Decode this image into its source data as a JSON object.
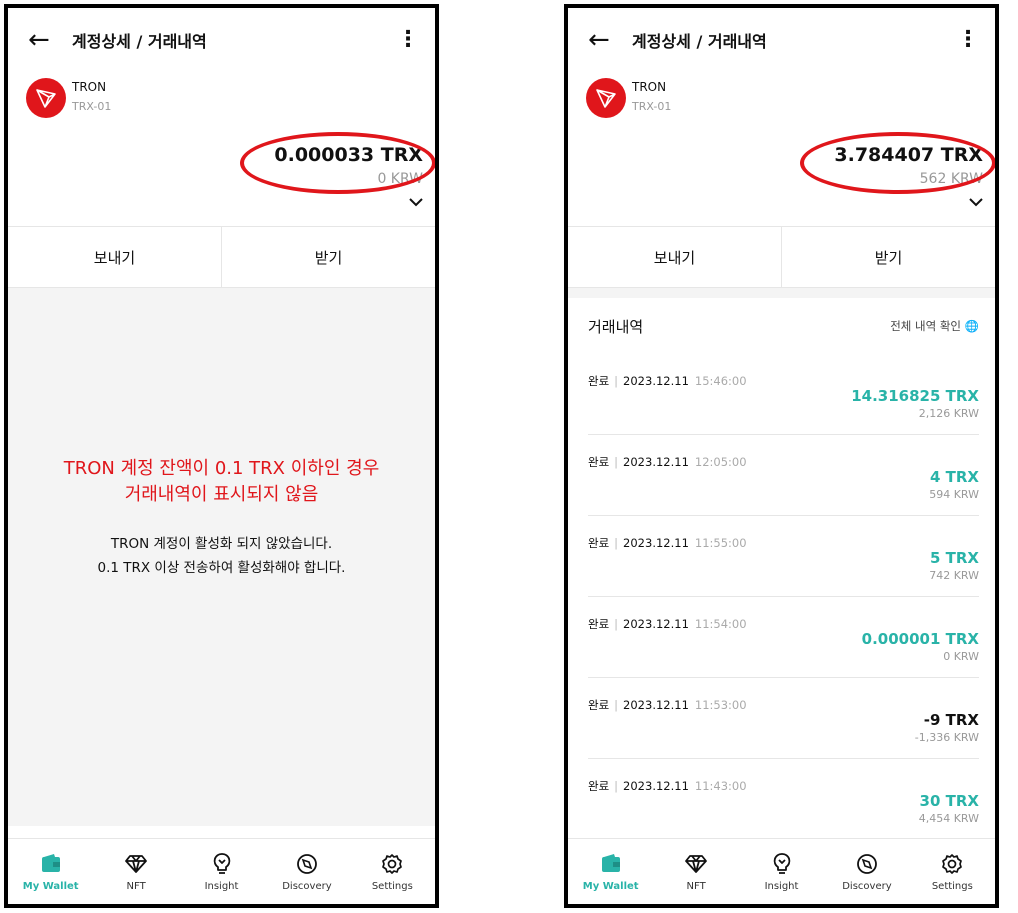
{
  "left": {
    "header": {
      "title": "계정상세 / 거래내역"
    },
    "coin": {
      "name": "TRON",
      "account": "TRX-01"
    },
    "balance": {
      "amount": "0.000033 TRX",
      "krw": "0 KRW"
    },
    "actions": {
      "send": "보내기",
      "receive": "받기"
    },
    "notice": {
      "highlight_line1": "TRON 계정 잔액이 0.1 TRX 이하인 경우",
      "highlight_line2": "거래내역이 표시되지 않음",
      "line1": "TRON 계정이 활성화 되지 않았습니다.",
      "line2": "0.1 TRX 이상 전송하여 활성화해야 합니다."
    }
  },
  "right": {
    "header": {
      "title": "계정상세 / 거래내역"
    },
    "coin": {
      "name": "TRON",
      "account": "TRX-01"
    },
    "balance": {
      "amount": "3.784407 TRX",
      "krw": "562 KRW"
    },
    "actions": {
      "send": "보내기",
      "receive": "받기"
    },
    "history": {
      "title": "거래내역",
      "view_all": "전체 내역 확인",
      "items": [
        {
          "status": "완료",
          "date": "2023.12.11",
          "time": "15:46:00",
          "amount": "14.316825 TRX",
          "krw": "2,126 KRW",
          "direction": "in"
        },
        {
          "status": "완료",
          "date": "2023.12.11",
          "time": "12:05:00",
          "amount": "4 TRX",
          "krw": "594 KRW",
          "direction": "in"
        },
        {
          "status": "완료",
          "date": "2023.12.11",
          "time": "11:55:00",
          "amount": "5 TRX",
          "krw": "742 KRW",
          "direction": "in"
        },
        {
          "status": "완료",
          "date": "2023.12.11",
          "time": "11:54:00",
          "amount": "0.000001 TRX",
          "krw": "0 KRW",
          "direction": "in"
        },
        {
          "status": "완료",
          "date": "2023.12.11",
          "time": "11:53:00",
          "amount": "-9 TRX",
          "krw": "-1,336 KRW",
          "direction": "out"
        },
        {
          "status": "완료",
          "date": "2023.12.11",
          "time": "11:43:00",
          "amount": "30 TRX",
          "krw": "4,454 KRW",
          "direction": "in"
        }
      ]
    }
  },
  "nav": {
    "items": [
      {
        "label": "My Wallet",
        "icon": "wallet-icon",
        "active": true
      },
      {
        "label": "NFT",
        "icon": "diamond-icon",
        "active": false
      },
      {
        "label": "Insight",
        "icon": "lightbulb-icon",
        "active": false
      },
      {
        "label": "Discovery",
        "icon": "compass-icon",
        "active": false
      },
      {
        "label": "Settings",
        "icon": "gear-icon",
        "active": false
      }
    ]
  },
  "colors": {
    "accent": "#29b3a8",
    "tron_red": "#e0161b",
    "annotation_red": "#e0161b"
  }
}
